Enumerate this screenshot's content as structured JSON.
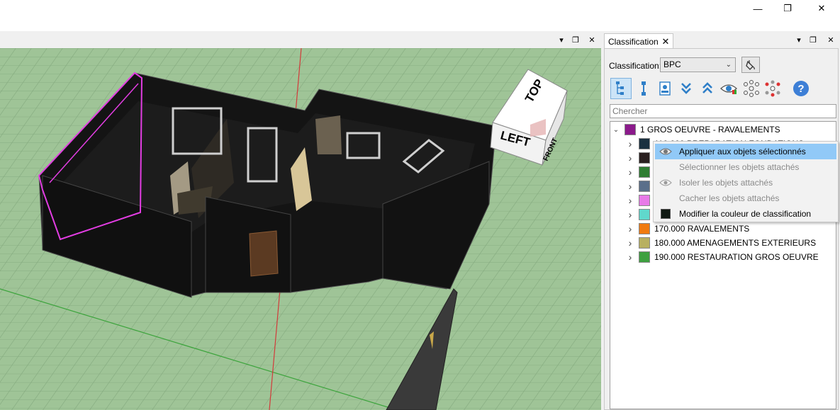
{
  "window": {
    "minimize_glyph": "—",
    "restore_glyph": "❐",
    "close_glyph": "✕"
  },
  "viewport": {
    "pane_menu_glyph": "▾",
    "pane_float_glyph": "❐",
    "pane_close_glyph": "✕",
    "nav_cube": {
      "top": "TOP",
      "left": "LEFT",
      "front": "FRONT"
    }
  },
  "panel": {
    "tab_title": "Classification",
    "tab_close": "✕",
    "menu_glyph": "▾",
    "float_glyph": "❐",
    "close_glyph": "✕",
    "classification_label": "Classification:",
    "classification_value": "BPC",
    "search_placeholder": "Chercher",
    "toolbar_icons": [
      "tree-view-icon",
      "link-icon",
      "document-icon",
      "expand-all-icon",
      "collapse-all-icon",
      "eye-visibility-icon",
      "network-icon",
      "network-color-icon",
      "help-icon"
    ],
    "tree": {
      "root": {
        "label": "1 GROS OEUVRE - RAVALEMENTS",
        "color": "#8b1a8b"
      },
      "items": [
        {
          "label": "110.000 PREPARATION FONDATIONS",
          "color": "#1a3040"
        },
        {
          "label": "",
          "color": "#2a2020"
        },
        {
          "label": "",
          "color": "#2e7d32"
        },
        {
          "label": "",
          "color": "#5a6f8a"
        },
        {
          "label": "",
          "color": "#e87ae8"
        },
        {
          "label": "",
          "color": "#60d8cc"
        },
        {
          "label": "170.000 RAVALEMENTS",
          "color": "#f07a10"
        },
        {
          "label": "180.000 AMENAGEMENTS EXTERIEURS",
          "color": "#b8b060"
        },
        {
          "label": "190.000 RESTAURATION GROS OEUVRE",
          "color": "#3ea040"
        }
      ]
    }
  },
  "context_menu": {
    "items": [
      {
        "label": "Appliquer aux objets sélectionnés",
        "icon": "apply-eye-icon",
        "state": "highlighted"
      },
      {
        "label": "Sélectionner les objets attachés",
        "icon": "",
        "state": "disabled"
      },
      {
        "label": "Isoler les objets attachés",
        "icon": "isolate-eye-icon",
        "state": "disabled"
      },
      {
        "label": "Cacher les objets attachés",
        "icon": "",
        "state": "disabled"
      },
      {
        "label": "Modifier la couleur de classification",
        "icon": "color-swatch-icon",
        "state": "normal",
        "swatch": "#111a14"
      }
    ]
  }
}
